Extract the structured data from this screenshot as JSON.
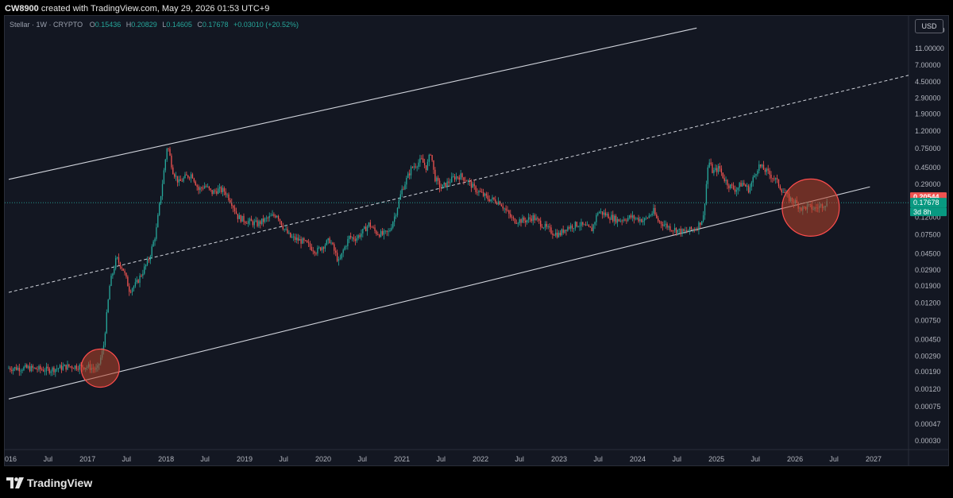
{
  "header": {
    "author": "CW8900",
    "text": " created with TradingView.com, May 29, 2026 01:53 UTC+9"
  },
  "legend": {
    "symbol": "Stellar · 1W · CRYPTO",
    "o_label": "O",
    "o_value": "0.15436",
    "h_label": "H",
    "h_value": "0.20829",
    "l_label": "L",
    "l_value": "0.14605",
    "c_label": "C",
    "c_value": "0.17678",
    "change": "+0.03010 (+20.52%)"
  },
  "currency_button": "USD",
  "footer": {
    "brand": "TradingView"
  },
  "colors": {
    "background": "#131722",
    "up": "#26a69a",
    "down": "#ef5350",
    "line": "#d1d4dc",
    "circle_fill": "#b8432a",
    "circle_stroke": "#ff4d4d"
  },
  "chart_data": {
    "type": "candlestick",
    "y_scale": "log",
    "y_ticks": [
      "18.00000",
      "11.00000",
      "7.00000",
      "4.50000",
      "2.90000",
      "1.90000",
      "1.20000",
      "0.75000",
      "0.45000",
      "0.29000",
      "0.19000",
      "0.12000",
      "0.07500",
      "0.04500",
      "0.02900",
      "0.01900",
      "0.01200",
      "0.00750",
      "0.00450",
      "0.00290",
      "0.00190",
      "0.00120",
      "0.00075",
      "0.00047",
      "0.00030"
    ],
    "x_labels": [
      "2016",
      "Jul",
      "2017",
      "Jul",
      "2018",
      "Jul",
      "2019",
      "Jul",
      "2020",
      "Jul",
      "2021",
      "Jul",
      "2022",
      "Jul",
      "2023",
      "Jul",
      "2024",
      "Jul",
      "2025",
      "Jul",
      "2026",
      "Jul",
      "2027"
    ],
    "price_labels": [
      {
        "text": "0.20544",
        "color": "#ef5350"
      },
      {
        "text": "0.17678",
        "color": "#089981"
      },
      {
        "text": "3d 8h",
        "color": "#089981"
      }
    ],
    "price_path": [
      [
        "2016-01-01",
        0.0021
      ],
      [
        "2016-04-01",
        0.0021
      ],
      [
        "2016-07-01",
        0.002
      ],
      [
        "2016-10-01",
        0.0022
      ],
      [
        "2017-01-01",
        0.0022
      ],
      [
        "2017-02-15",
        0.002
      ],
      [
        "2017-03-15",
        0.0035
      ],
      [
        "2017-04-15",
        0.02
      ],
      [
        "2017-05-15",
        0.04
      ],
      [
        "2017-06-15",
        0.03
      ],
      [
        "2017-07-15",
        0.017
      ],
      [
        "2017-08-15",
        0.02
      ],
      [
        "2017-09-15",
        0.028
      ],
      [
        "2017-10-15",
        0.04
      ],
      [
        "2017-11-15",
        0.08
      ],
      [
        "2017-12-15",
        0.3
      ],
      [
        "2018-01-07",
        0.85
      ],
      [
        "2018-02-01",
        0.42
      ],
      [
        "2018-03-01",
        0.3
      ],
      [
        "2018-04-01",
        0.35
      ],
      [
        "2018-05-01",
        0.38
      ],
      [
        "2018-06-01",
        0.25
      ],
      [
        "2018-07-01",
        0.28
      ],
      [
        "2018-08-01",
        0.23
      ],
      [
        "2018-09-01",
        0.25
      ],
      [
        "2018-10-01",
        0.24
      ],
      [
        "2018-11-01",
        0.18
      ],
      [
        "2018-12-01",
        0.12
      ],
      [
        "2019-01-01",
        0.11
      ],
      [
        "2019-03-01",
        0.1
      ],
      [
        "2019-04-01",
        0.11
      ],
      [
        "2019-05-01",
        0.12
      ],
      [
        "2019-06-01",
        0.13
      ],
      [
        "2019-07-01",
        0.09
      ],
      [
        "2019-08-01",
        0.07
      ],
      [
        "2019-10-01",
        0.062
      ],
      [
        "2019-12-01",
        0.048
      ],
      [
        "2020-02-01",
        0.065
      ],
      [
        "2020-03-15",
        0.035
      ],
      [
        "2020-04-01",
        0.048
      ],
      [
        "2020-05-01",
        0.07
      ],
      [
        "2020-06-01",
        0.068
      ],
      [
        "2020-07-01",
        0.08
      ],
      [
        "2020-08-01",
        0.1
      ],
      [
        "2020-09-01",
        0.08
      ],
      [
        "2020-10-01",
        0.075
      ],
      [
        "2020-11-01",
        0.08
      ],
      [
        "2020-12-01",
        0.13
      ],
      [
        "2021-01-01",
        0.25
      ],
      [
        "2021-02-15",
        0.45
      ],
      [
        "2021-04-01",
        0.55
      ],
      [
        "2021-04-25",
        0.45
      ],
      [
        "2021-05-15",
        0.7
      ],
      [
        "2021-06-01",
        0.35
      ],
      [
        "2021-07-01",
        0.26
      ],
      [
        "2021-08-01",
        0.3
      ],
      [
        "2021-09-01",
        0.35
      ],
      [
        "2021-10-01",
        0.36
      ],
      [
        "2021-11-01",
        0.32
      ],
      [
        "2021-12-01",
        0.26
      ],
      [
        "2022-02-01",
        0.2
      ],
      [
        "2022-04-01",
        0.18
      ],
      [
        "2022-05-01",
        0.14
      ],
      [
        "2022-06-01",
        0.11
      ],
      [
        "2022-08-01",
        0.11
      ],
      [
        "2022-09-01",
        0.12
      ],
      [
        "2022-11-01",
        0.09
      ],
      [
        "2022-12-01",
        0.08
      ],
      [
        "2023-01-01",
        0.075
      ],
      [
        "2023-02-01",
        0.09
      ],
      [
        "2023-04-01",
        0.1
      ],
      [
        "2023-06-01",
        0.085
      ],
      [
        "2023-07-01",
        0.14
      ],
      [
        "2023-08-01",
        0.13
      ],
      [
        "2023-10-01",
        0.11
      ],
      [
        "2023-12-01",
        0.12
      ],
      [
        "2024-02-01",
        0.11
      ],
      [
        "2024-03-15",
        0.14
      ],
      [
        "2024-04-01",
        0.11
      ],
      [
        "2024-06-01",
        0.09
      ],
      [
        "2024-08-01",
        0.08
      ],
      [
        "2024-10-01",
        0.09
      ],
      [
        "2024-11-01",
        0.12
      ],
      [
        "2024-11-25",
        0.55
      ],
      [
        "2024-12-15",
        0.4
      ],
      [
        "2025-01-15",
        0.45
      ],
      [
        "2025-02-01",
        0.35
      ],
      [
        "2025-03-01",
        0.28
      ],
      [
        "2025-04-01",
        0.25
      ],
      [
        "2025-05-01",
        0.3
      ],
      [
        "2025-06-01",
        0.25
      ],
      [
        "2025-07-15",
        0.48
      ],
      [
        "2025-08-15",
        0.42
      ],
      [
        "2025-10-01",
        0.33
      ],
      [
        "2025-11-01",
        0.25
      ],
      [
        "2025-12-01",
        0.2
      ],
      [
        "2026-01-01",
        0.18
      ],
      [
        "2026-02-01",
        0.15
      ],
      [
        "2026-03-01",
        0.16
      ],
      [
        "2026-04-01",
        0.15
      ],
      [
        "2026-05-29",
        0.17678
      ]
    ],
    "channel": {
      "lower": [
        [
          "2016-01-01",
          0.00092
        ],
        [
          "2026-12-15",
          0.27
        ]
      ],
      "middle": [
        [
          "2016-01-01",
          0.016
        ],
        [
          "2027-07-01",
          5.5
        ]
      ],
      "upper": [
        [
          "2016-01-01",
          0.33
        ],
        [
          "2024-10-01",
          19.0
        ]
      ]
    },
    "highlights": [
      {
        "center": [
          "2017-03-01",
          0.0021
        ]
      },
      {
        "center": [
          "2026-03-15",
          0.155
        ]
      }
    ]
  }
}
